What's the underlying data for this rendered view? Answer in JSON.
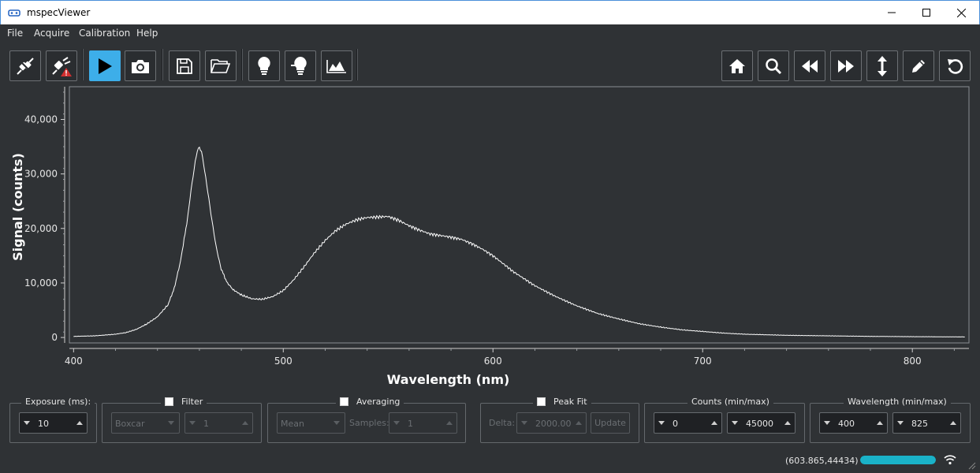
{
  "window": {
    "title": "mspecViewer"
  },
  "menu": {
    "items": [
      "File",
      "Acquire",
      "Calibration",
      "Help"
    ]
  },
  "toolbar": {
    "left_buttons": [
      {
        "icon": "disconnect-icon",
        "active": false
      },
      {
        "icon": "connect-warning-icon",
        "active": false
      },
      {
        "icon": "play-icon",
        "active": true
      },
      {
        "icon": "camera-icon",
        "active": false
      },
      {
        "icon": "save-icon",
        "active": false
      },
      {
        "icon": "open-folder-icon",
        "active": false
      },
      {
        "icon": "lamp-dark-icon",
        "active": false
      },
      {
        "icon": "lamp-reference-icon",
        "active": false
      },
      {
        "icon": "spectrum-area-icon",
        "active": false
      }
    ],
    "right_buttons": [
      {
        "icon": "home-icon"
      },
      {
        "icon": "zoom-icon"
      },
      {
        "icon": "back-icon"
      },
      {
        "icon": "forward-icon"
      },
      {
        "icon": "vertical-arrows-icon"
      },
      {
        "icon": "pencil-icon"
      },
      {
        "icon": "reset-icon"
      }
    ]
  },
  "chart_data": {
    "type": "line",
    "xlabel": "Wavelength (nm)",
    "ylabel": "Signal (counts)",
    "xlim": [
      398,
      827
    ],
    "ylim": [
      -1000,
      46000
    ],
    "xticks": [
      400,
      500,
      600,
      700,
      800
    ],
    "xtick_labels": [
      "400",
      "500",
      "600",
      "700",
      "800"
    ],
    "yticks": [
      0,
      10000,
      20000,
      30000,
      40000
    ],
    "ytick_labels": [
      "0",
      "10,000",
      "20,000",
      "30,000",
      "40,000"
    ],
    "grid": false,
    "series": [
      {
        "color": "#ffffff",
        "x": [
          400,
          410,
          420,
          425,
          430,
          435,
          440,
          445,
          448,
          451,
          454,
          456,
          458,
          459,
          460,
          461,
          462,
          464,
          466,
          468,
          470,
          473,
          476,
          480,
          485,
          490,
          495,
          500,
          505,
          510,
          515,
          520,
          525,
          530,
          535,
          540,
          545,
          550,
          555,
          560,
          565,
          570,
          575,
          580,
          585,
          590,
          595,
          600,
          610,
          620,
          630,
          640,
          650,
          660,
          670,
          680,
          690,
          700,
          710,
          720,
          740,
          760,
          780,
          800,
          825
        ],
        "y": [
          200,
          300,
          600,
          900,
          1500,
          2500,
          3800,
          6000,
          9000,
          14000,
          21000,
          27000,
          32000,
          34000,
          34700,
          34000,
          32000,
          27000,
          21500,
          16500,
          13000,
          10200,
          8800,
          7800,
          7100,
          7000,
          7500,
          8600,
          10600,
          13000,
          15600,
          17800,
          19600,
          20800,
          21600,
          22000,
          22100,
          22200,
          21500,
          20500,
          19700,
          19000,
          18700,
          18400,
          18000,
          17200,
          16200,
          15000,
          12000,
          9500,
          7500,
          5800,
          4400,
          3400,
          2500,
          1900,
          1400,
          1100,
          800,
          600,
          400,
          300,
          200,
          150,
          100
        ]
      }
    ]
  },
  "controls": {
    "exposure": {
      "label": "Exposure (ms):",
      "value": "10"
    },
    "filter": {
      "label": "Filter",
      "type": "Boxcar",
      "value": "1"
    },
    "averaging": {
      "label": "Averaging",
      "mode": "Mean",
      "samples_label": "Samples:",
      "samples": "1"
    },
    "peak_fit": {
      "label": "Peak Fit",
      "delta_label": "Delta:",
      "delta": "2000.00",
      "update_label": "Update"
    },
    "counts": {
      "label": "Counts (min/max)",
      "min": "0",
      "max": "45000"
    },
    "wavelength": {
      "label": "Wavelength (min/max)",
      "min": "400",
      "max": "825"
    }
  },
  "status": {
    "coords": "(603.865,44434)",
    "progress": 1.0
  },
  "colors": {
    "background": "#2f3235",
    "accent": "#3daee9",
    "progress": "#1ab2c8",
    "trace": "#ffffff"
  }
}
